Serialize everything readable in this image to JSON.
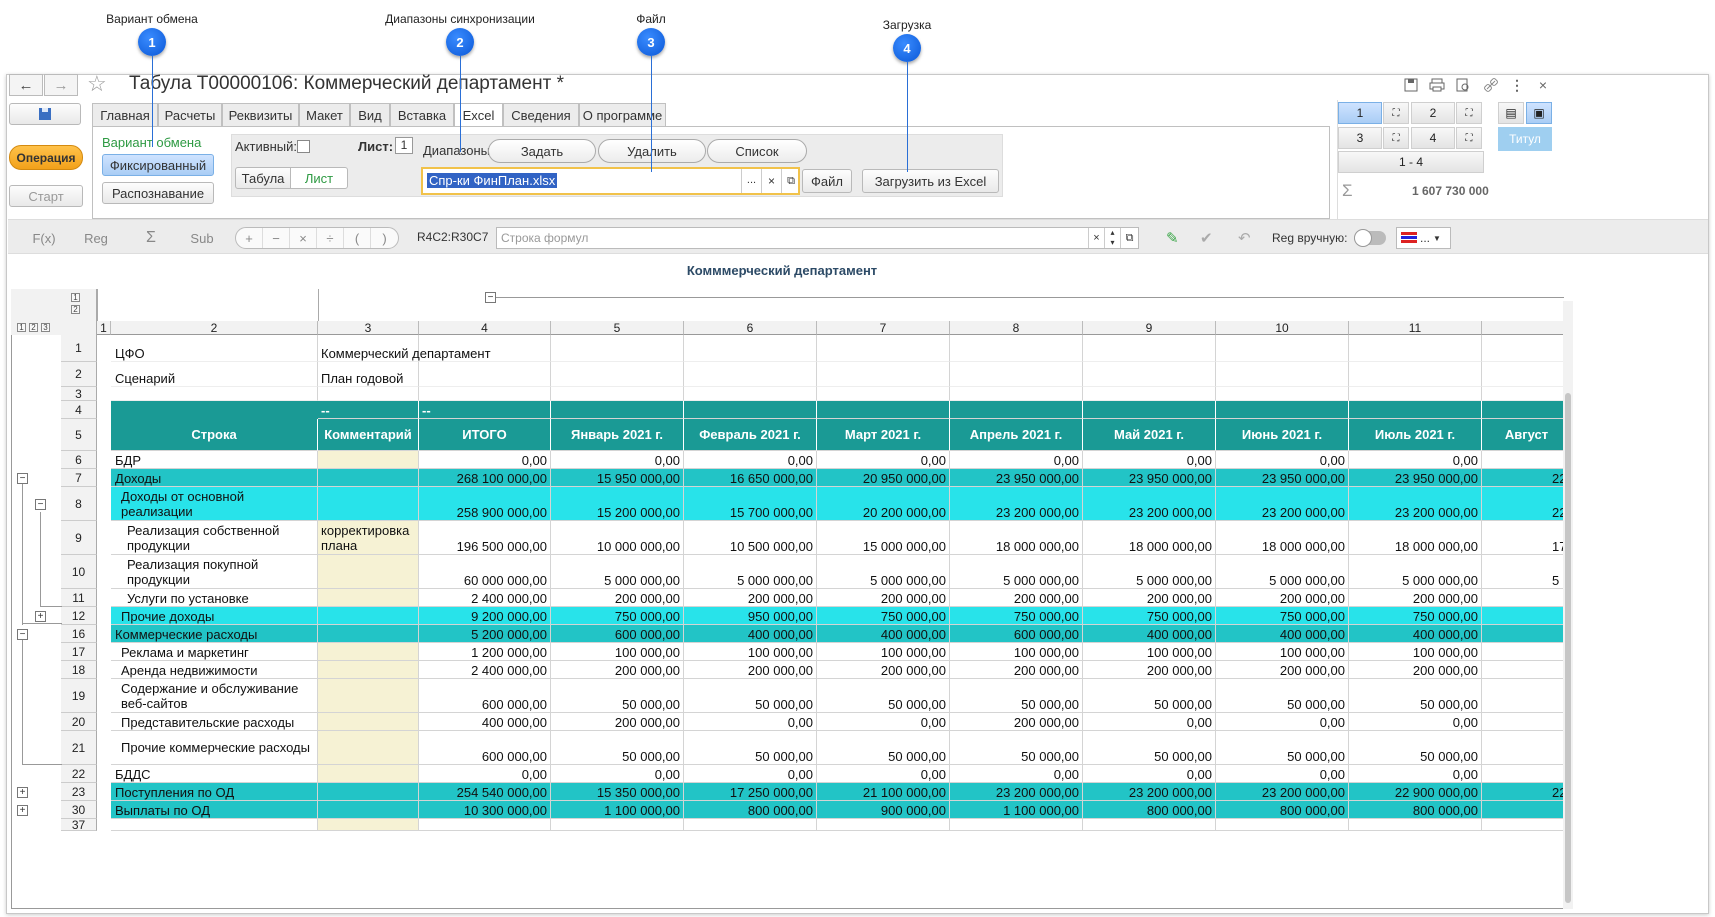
{
  "callouts": [
    {
      "num": "1",
      "label": "Вариант обмена"
    },
    {
      "num": "2",
      "label": "Диапазоны синхронизации"
    },
    {
      "num": "3",
      "label": "Файл"
    },
    {
      "num": "4",
      "label": "Загрузка"
    }
  ],
  "window": {
    "title": "Табула Т00000106: Коммерческий департамент *",
    "back_icon": "←",
    "forward_icon": "→",
    "star_icon": "☆",
    "toolbar_icons": [
      "save-icon",
      "print-icon",
      "preview-icon",
      "link-icon",
      "more-icon",
      "close-icon"
    ]
  },
  "left_panel": {
    "operation": "Операция",
    "start": "Старт"
  },
  "tabs": [
    "Главная",
    "Расчеты",
    "Реквизиты",
    "Макет",
    "Вид",
    "Вставка",
    "Excel",
    "Сведения",
    "О программе"
  ],
  "active_tab": "Excel",
  "exchange": {
    "label": "Вариант обмена",
    "fixed": "Фиксированный",
    "recognition": "Распознавание"
  },
  "excel": {
    "active_label": "Активный:",
    "sheet_label": "Лист:",
    "sheet_value": "1",
    "table_btn": "Табула",
    "sheet_btn": "Лист",
    "ranges_label": "Диапазоны:",
    "set": "Задать",
    "delete": "Удалить",
    "list": "Список",
    "file_value": "Спр-ки ФинПлан.xlsx",
    "file_btn": "Файл",
    "load_btn": "Загрузить из Excel"
  },
  "right_panel": {
    "cells": [
      "1",
      "2",
      "3",
      "4"
    ],
    "range": "1  -  4",
    "sum_symbol": "Σ",
    "sum": "1 607 730 000",
    "title_btn": "Титул"
  },
  "formula": {
    "fx": "F(x)",
    "reg": "Reg",
    "sigma": "Σ",
    "sub": "Sub",
    "ops": [
      "+",
      "−",
      "×",
      "÷",
      "(",
      ")"
    ],
    "ref": "R4C2:R30C7",
    "placeholder": "Строка формул",
    "reg_manual": "Reg вручную:",
    "color_btn": "..."
  },
  "sheet": {
    "title": "Комммерческий департамент",
    "colors": {
      "header": "#1a9a95",
      "level1": "#22c4c6",
      "level2": "#28e3ea",
      "comment": "#f6f2d4"
    },
    "col_nums": [
      "1",
      "2",
      "3",
      "4",
      "5",
      "6",
      "7",
      "8",
      "9",
      "10",
      "11",
      ""
    ],
    "info": [
      {
        "num": "1",
        "label": "ЦФО",
        "value": "Коммерческий департамент"
      },
      {
        "num": "2",
        "label": "Сценарий",
        "value": "План годовой"
      },
      {
        "num": "3",
        "label": "",
        "value": ""
      }
    ],
    "dash_row": {
      "num": "4",
      "c3": "--",
      "c4": "--"
    },
    "header": {
      "num": "5",
      "cols": [
        "Строка",
        "Комментарий",
        "ИТОГО",
        "Январь 2021 г.",
        "Февраль 2021 г.",
        "Март 2021 г.",
        "Апрель 2021 г.",
        "Май 2021 г.",
        "Июнь 2021 г.",
        "Июль 2021 г.",
        "Август"
      ]
    },
    "rows": [
      {
        "num": "6",
        "name": "БДР",
        "style": "plain",
        "comment": "",
        "vals": [
          "0,00",
          "0,00",
          "0,00",
          "0,00",
          "0,00",
          "0,00",
          "0,00",
          "0,00"
        ],
        "extra": ""
      },
      {
        "num": "7",
        "name": "Доходы",
        "style": "l1",
        "comment": "",
        "vals": [
          "268 100 000,00",
          "15 950 000,00",
          "16 650 000,00",
          "20 950 000,00",
          "23 950 000,00",
          "23 950 000,00",
          "23 950 000,00",
          "23 950 000,00"
        ],
        "extra": "22"
      },
      {
        "num": "8",
        "name": "Доходы от основной реализации",
        "style": "l2",
        "comment": "",
        "vals": [
          "258 900 000,00",
          "15 200 000,00",
          "15 700 000,00",
          "20 200 000,00",
          "23 200 000,00",
          "23 200 000,00",
          "23 200 000,00",
          "23 200 000,00"
        ],
        "extra": "22"
      },
      {
        "num": "9",
        "name": "Реализация собственной продукции",
        "style": "plain",
        "comment": "корректировка плана",
        "vals": [
          "196 500 000,00",
          "10 000 000,00",
          "10 500 000,00",
          "15 000 000,00",
          "18 000 000,00",
          "18 000 000,00",
          "18 000 000,00",
          "18 000 000,00"
        ],
        "extra": "17"
      },
      {
        "num": "10",
        "name": "Реализация покупной продукции",
        "style": "plain",
        "comment": "",
        "vals": [
          "60 000 000,00",
          "5 000 000,00",
          "5 000 000,00",
          "5 000 000,00",
          "5 000 000,00",
          "5 000 000,00",
          "5 000 000,00",
          "5 000 000,00"
        ],
        "extra": "5"
      },
      {
        "num": "11",
        "name": "Услуги по установке",
        "style": "plain",
        "comment": "",
        "vals": [
          "2 400 000,00",
          "200 000,00",
          "200 000,00",
          "200 000,00",
          "200 000,00",
          "200 000,00",
          "200 000,00",
          "200 000,00"
        ],
        "extra": ""
      },
      {
        "num": "12",
        "name": "Прочие доходы",
        "style": "l2",
        "comment": "",
        "vals": [
          "9 200 000,00",
          "750 000,00",
          "950 000,00",
          "750 000,00",
          "750 000,00",
          "750 000,00",
          "750 000,00",
          "750 000,00"
        ],
        "extra": ""
      },
      {
        "num": "16",
        "name": "Коммерческие расходы",
        "style": "l1",
        "comment": "",
        "vals": [
          "5 200 000,00",
          "600 000,00",
          "400 000,00",
          "400 000,00",
          "600 000,00",
          "400 000,00",
          "400 000,00",
          "400 000,00"
        ],
        "extra": ""
      },
      {
        "num": "17",
        "name": "Реклама и маркетинг",
        "style": "plain",
        "comment": "",
        "vals": [
          "1 200 000,00",
          "100 000,00",
          "100 000,00",
          "100 000,00",
          "100 000,00",
          "100 000,00",
          "100 000,00",
          "100 000,00"
        ],
        "extra": ""
      },
      {
        "num": "18",
        "name": "Аренда недвижимости",
        "style": "plain",
        "comment": "",
        "vals": [
          "2 400 000,00",
          "200 000,00",
          "200 000,00",
          "200 000,00",
          "200 000,00",
          "200 000,00",
          "200 000,00",
          "200 000,00"
        ],
        "extra": ""
      },
      {
        "num": "19",
        "name": "Содержание и обслуживание веб-сайтов",
        "style": "plain",
        "comment": "",
        "vals": [
          "600 000,00",
          "50 000,00",
          "50 000,00",
          "50 000,00",
          "50 000,00",
          "50 000,00",
          "50 000,00",
          "50 000,00"
        ],
        "extra": ""
      },
      {
        "num": "20",
        "name": "Представительские расходы",
        "style": "plain",
        "comment": "",
        "vals": [
          "400 000,00",
          "200 000,00",
          "0,00",
          "0,00",
          "200 000,00",
          "0,00",
          "0,00",
          "0,00"
        ],
        "extra": ""
      },
      {
        "num": "21",
        "name": "Прочие коммерческие расходы",
        "style": "plain",
        "comment": "",
        "vals": [
          "600 000,00",
          "50 000,00",
          "50 000,00",
          "50 000,00",
          "50 000,00",
          "50 000,00",
          "50 000,00",
          "50 000,00"
        ],
        "extra": ""
      },
      {
        "num": "22",
        "name": "БДДС",
        "style": "plain",
        "comment": "",
        "vals": [
          "0,00",
          "0,00",
          "0,00",
          "0,00",
          "0,00",
          "0,00",
          "0,00",
          "0,00"
        ],
        "extra": ""
      },
      {
        "num": "23",
        "name": "Поступления по ОД",
        "style": "l1",
        "comment": "",
        "vals": [
          "254 540 000,00",
          "15 350 000,00",
          "17 250 000,00",
          "21 100 000,00",
          "23 200 000,00",
          "23 200 000,00",
          "23 200 000,00",
          "22 900 000,00"
        ],
        "extra": "22"
      },
      {
        "num": "30",
        "name": "Выплаты по ОД",
        "style": "l1",
        "comment": "",
        "vals": [
          "10 300 000,00",
          "1 100 000,00",
          "800 000,00",
          "900 000,00",
          "1 100 000,00",
          "800 000,00",
          "800 000,00",
          "800 000,00"
        ],
        "extra": ""
      },
      {
        "num": "37",
        "name": "",
        "style": "plain",
        "comment": "",
        "vals": [
          "",
          "",
          "",
          "",
          "",
          "",
          "",
          ""
        ],
        "extra": ""
      }
    ]
  }
}
